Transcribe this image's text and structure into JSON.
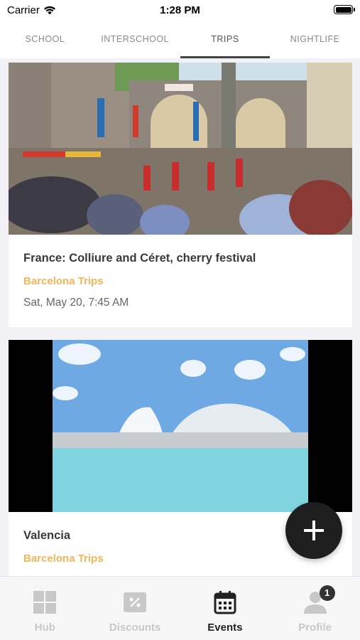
{
  "status": {
    "carrier": "Carrier",
    "time": "1:28 PM"
  },
  "tabs": [
    {
      "label": "SCHOOL"
    },
    {
      "label": "INTERSCHOOL"
    },
    {
      "label": "TRIPS"
    },
    {
      "label": "NIGHTLIFE"
    }
  ],
  "active_tab": "TRIPS",
  "events": [
    {
      "title": "France: Colliure and Céret, cherry festival",
      "organizer": "Barcelona Trips",
      "date": "Sat, May 20, 7:45 AM"
    },
    {
      "title": "Valencia",
      "organizer": "Barcelona Trips",
      "date": ""
    }
  ],
  "fab": {
    "icon": "plus-icon"
  },
  "nav": [
    {
      "label": "Hub",
      "icon": "grid-icon"
    },
    {
      "label": "Discounts",
      "icon": "discount-icon"
    },
    {
      "label": "Events",
      "icon": "calendar-icon"
    },
    {
      "label": "Profile",
      "icon": "person-icon",
      "badge": "1"
    }
  ],
  "active_nav": "Events",
  "colors": {
    "accent": "#f5b45a",
    "fab": "#1e1e1e",
    "active_tab": "#444444",
    "inactive": "#c8c8c8"
  }
}
